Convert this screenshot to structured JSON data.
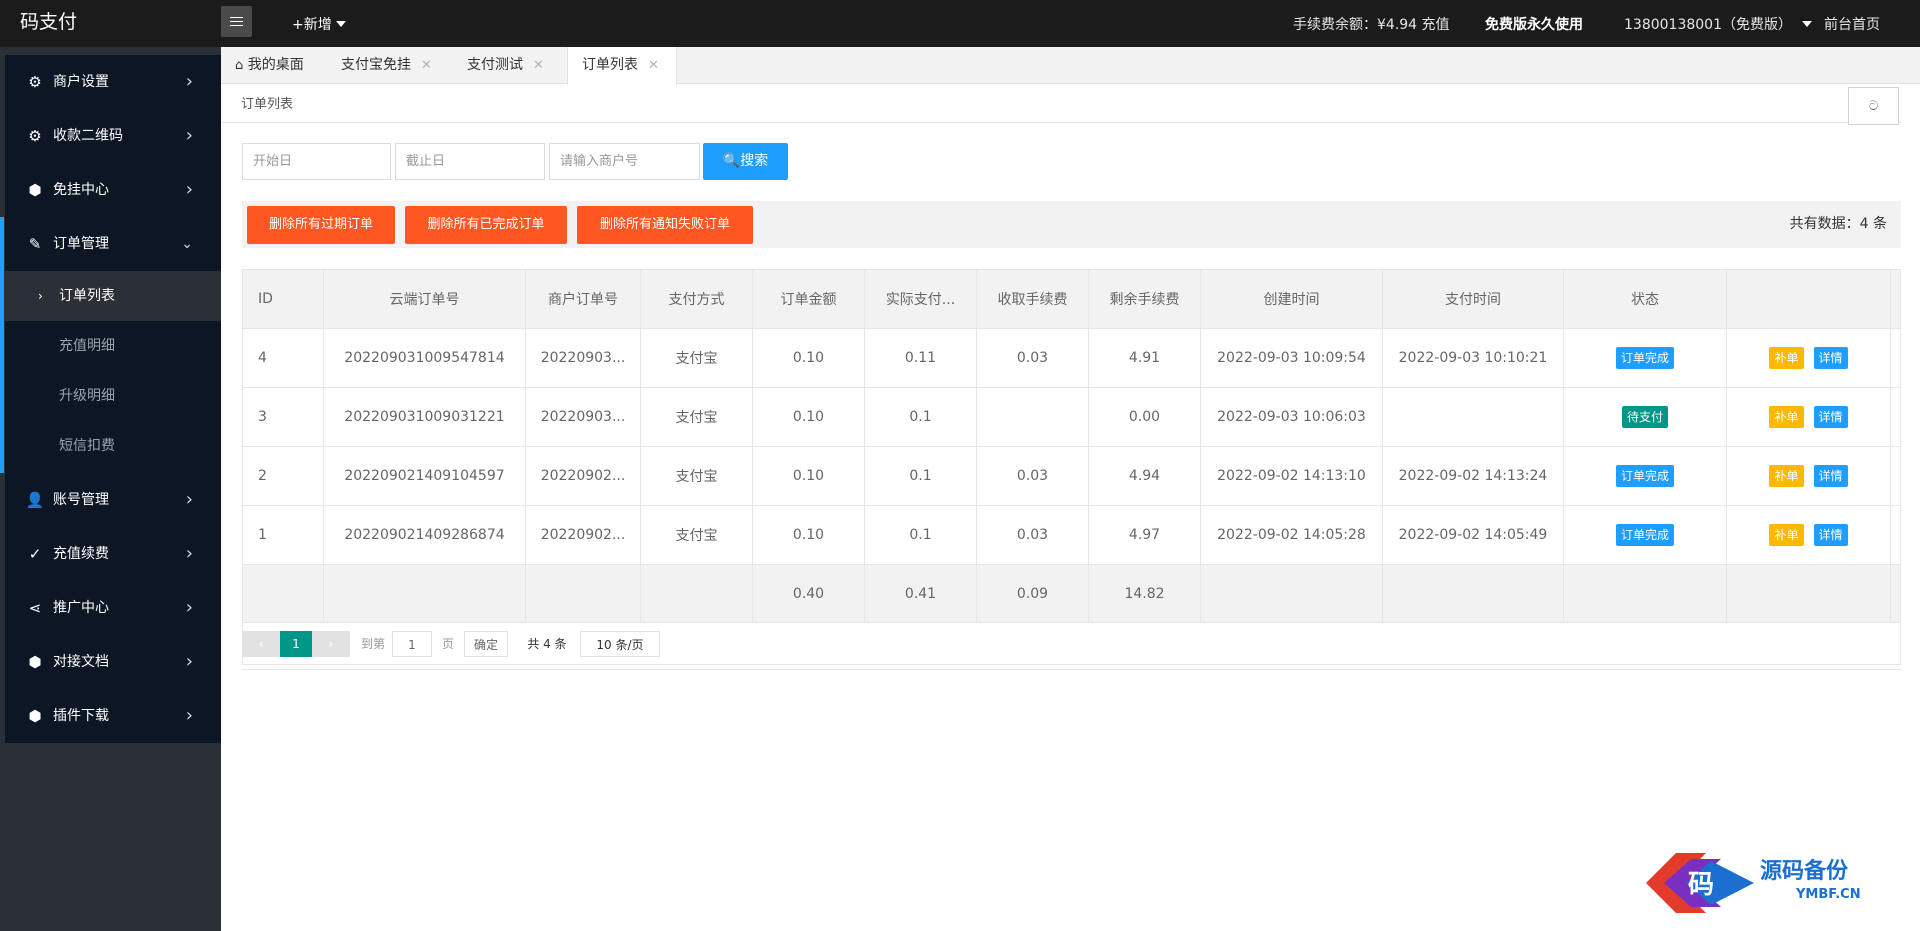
{
  "app": {
    "logo": "码支付"
  },
  "topbar": {
    "add_new": "+新增",
    "balance": "手续费余额：¥4.94 充值",
    "plan": "免费版永久使用",
    "account": "13800138001（免费版）",
    "front_home": "前台首页"
  },
  "sidebar": {
    "items": [
      {
        "label": "商户设置",
        "icon": "gear-icon"
      },
      {
        "label": "收款二维码",
        "icon": "gear-icon"
      },
      {
        "label": "免挂中心",
        "icon": "cube-icon"
      },
      {
        "label": "订单管理",
        "icon": "edit-icon"
      },
      {
        "label": "账号管理",
        "icon": "user-icon"
      },
      {
        "label": "充值续费",
        "icon": "check-icon"
      },
      {
        "label": "推广中心",
        "icon": "share-icon"
      },
      {
        "label": "对接文档",
        "icon": "cube-icon"
      },
      {
        "label": "插件下载",
        "icon": "cube-icon"
      }
    ],
    "submenu": [
      {
        "label": "订单列表",
        "active": true
      },
      {
        "label": "充值明细",
        "active": false
      },
      {
        "label": "升级明细",
        "active": false
      },
      {
        "label": "短信扣费",
        "active": false
      }
    ]
  },
  "tabs": [
    {
      "label": "我的桌面",
      "closable": false,
      "icon": "home-icon"
    },
    {
      "label": "支付宝免挂",
      "closable": true
    },
    {
      "label": "支付测试",
      "closable": true
    },
    {
      "label": "订单列表",
      "closable": true,
      "active": true
    }
  ],
  "page": {
    "breadcrumb": "订单列表",
    "refresh_icon": "refresh-icon",
    "refresh_glyph": "ට"
  },
  "filters": {
    "start_placeholder": "开始日",
    "end_placeholder": "截止日",
    "merchant_placeholder": "请输入商户号",
    "search_label": "搜索"
  },
  "actions": {
    "delete_expired": "删除所有过期订单",
    "delete_completed": "删除所有已完成订单",
    "delete_failed": "删除所有通知失败订单",
    "total_label": "共有数据：4 条"
  },
  "table": {
    "columns": [
      "ID",
      "云端订单号",
      "商户订单号",
      "支付方式",
      "订单金额",
      "实际支付...",
      "收取手续费",
      "剩余手续费",
      "创建时间",
      "支付时间",
      "状态",
      ""
    ],
    "rows": [
      {
        "id": "4",
        "cloud_no": "202209031009547814",
        "merchant_no": "20220903...",
        "method": "支付宝",
        "amount": "0.10",
        "paid": "0.11",
        "fee": "0.03",
        "remaining": "4.91",
        "created": "2022-09-03 10:09:54",
        "paid_at": "2022-09-03 10:10:21",
        "status": "订单完成",
        "status_color": "#1e9fff"
      },
      {
        "id": "3",
        "cloud_no": "202209031009031221",
        "merchant_no": "20220903...",
        "method": "支付宝",
        "amount": "0.10",
        "paid": "0.1",
        "fee": "",
        "remaining": "0.00",
        "created": "2022-09-03 10:06:03",
        "paid_at": "",
        "status": "待支付",
        "status_color": "#009688"
      },
      {
        "id": "2",
        "cloud_no": "202209021409104597",
        "merchant_no": "20220902...",
        "method": "支付宝",
        "amount": "0.10",
        "paid": "0.1",
        "fee": "0.03",
        "remaining": "4.94",
        "created": "2022-09-02 14:13:10",
        "paid_at": "2022-09-02 14:13:24",
        "status": "订单完成",
        "status_color": "#1e9fff"
      },
      {
        "id": "1",
        "cloud_no": "202209021409286874",
        "merchant_no": "20220902...",
        "method": "支付宝",
        "amount": "0.10",
        "paid": "0.1",
        "fee": "0.03",
        "remaining": "4.97",
        "created": "2022-09-02 14:05:28",
        "paid_at": "2022-09-02 14:05:49",
        "status": "订单完成",
        "status_color": "#1e9fff"
      }
    ],
    "row_actions": {
      "supplement": "补单",
      "detail": "详情"
    },
    "totals": {
      "amount": "0.40",
      "paid": "0.41",
      "fee": "0.09",
      "remaining": "14.82"
    }
  },
  "pagination": {
    "current": "1",
    "goto_label": "到第",
    "page_input": "1",
    "page_unit": "页",
    "confirm": "确定",
    "total": "共 4 条",
    "per_page": "10 条/页"
  },
  "watermark": {
    "glyph": "码",
    "text": "源码备份",
    "domain": "YMBF.CN"
  },
  "colors": {
    "accent_blue": "#1e9fff",
    "danger": "#ff5722",
    "warm": "#ffb800",
    "teal": "#009688",
    "sidebar_bg": "#0c1624",
    "topbar_bg": "#1b1b1b"
  }
}
